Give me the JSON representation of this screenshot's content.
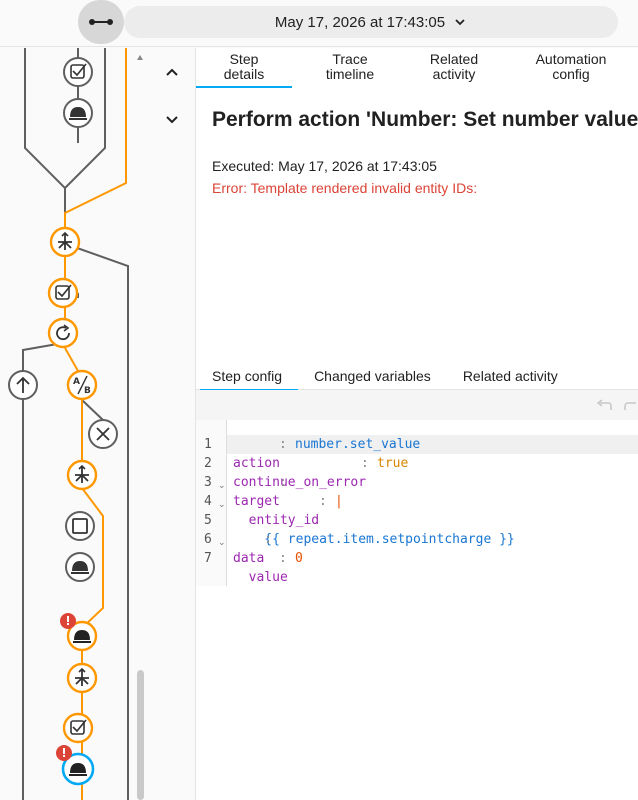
{
  "topbar": {
    "collapse_icon": "collapse-horizontal-icon",
    "run_date": "May 17, 2026 at 17:43:05"
  },
  "graph": {
    "colors": {
      "active": "#ff9800",
      "inactive": "#5f5f5f",
      "node_bg": "#ffffff",
      "selected": "#03a9f4",
      "error": "#db4437"
    }
  },
  "tabs": [
    {
      "label": "Step details",
      "active": true
    },
    {
      "label": "Trace timeline",
      "active": false
    },
    {
      "label": "Related activity",
      "active": false
    },
    {
      "label": "Automation config",
      "active": false
    }
  ],
  "step": {
    "title": "Perform action 'Number: Set number value'",
    "executed": "Executed: May 17, 2026 at 17:43:05",
    "error": "Error: Template rendered invalid entity IDs:"
  },
  "subtabs": [
    {
      "label": "Step config",
      "active": true
    },
    {
      "label": "Changed variables",
      "active": false
    },
    {
      "label": "Related activity",
      "active": false
    }
  ],
  "code": {
    "lines": [
      {
        "num": "1",
        "key": "action",
        "sep": ": ",
        "val": "number.set_value",
        "valtype": "v"
      },
      {
        "num": "2",
        "key": "continue_on_error",
        "sep": ": ",
        "val": "true",
        "valtype": "b"
      },
      {
        "num": "3",
        "key": "target",
        "sep": ":",
        "val": "",
        "valtype": "v"
      },
      {
        "num": "4",
        "key": "  entity_id",
        "sep": ": ",
        "val": "|",
        "valtype": "n"
      },
      {
        "num": "5",
        "key": "",
        "sep": "",
        "val": "    {{ repeat.item.setpointcharge }}",
        "valtype": "v"
      },
      {
        "num": "6",
        "key": "data",
        "sep": ":",
        "val": "",
        "valtype": "v"
      },
      {
        "num": "7",
        "key": "  value",
        "sep": ": ",
        "val": "0",
        "valtype": "n"
      }
    ]
  }
}
